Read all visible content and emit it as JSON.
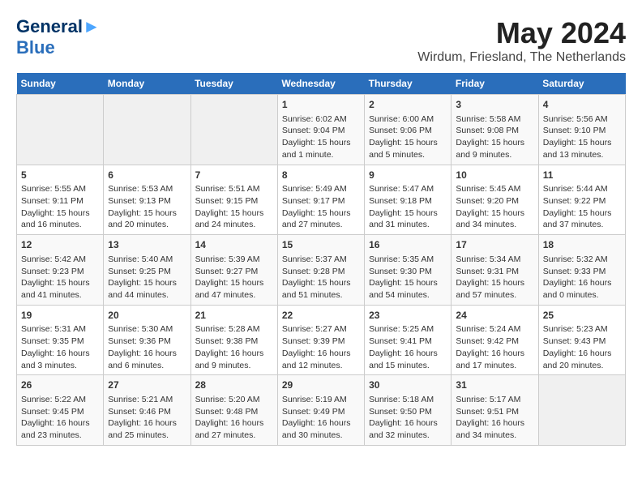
{
  "header": {
    "logo_line1": "General",
    "logo_line2": "Blue",
    "month": "May 2024",
    "location": "Wirdum, Friesland, The Netherlands"
  },
  "weekdays": [
    "Sunday",
    "Monday",
    "Tuesday",
    "Wednesday",
    "Thursday",
    "Friday",
    "Saturday"
  ],
  "weeks": [
    [
      {
        "day": "",
        "sunrise": "",
        "sunset": "",
        "daylight": ""
      },
      {
        "day": "",
        "sunrise": "",
        "sunset": "",
        "daylight": ""
      },
      {
        "day": "",
        "sunrise": "",
        "sunset": "",
        "daylight": ""
      },
      {
        "day": "1",
        "sunrise": "Sunrise: 6:02 AM",
        "sunset": "Sunset: 9:04 PM",
        "daylight": "Daylight: 15 hours and 1 minute."
      },
      {
        "day": "2",
        "sunrise": "Sunrise: 6:00 AM",
        "sunset": "Sunset: 9:06 PM",
        "daylight": "Daylight: 15 hours and 5 minutes."
      },
      {
        "day": "3",
        "sunrise": "Sunrise: 5:58 AM",
        "sunset": "Sunset: 9:08 PM",
        "daylight": "Daylight: 15 hours and 9 minutes."
      },
      {
        "day": "4",
        "sunrise": "Sunrise: 5:56 AM",
        "sunset": "Sunset: 9:10 PM",
        "daylight": "Daylight: 15 hours and 13 minutes."
      }
    ],
    [
      {
        "day": "5",
        "sunrise": "Sunrise: 5:55 AM",
        "sunset": "Sunset: 9:11 PM",
        "daylight": "Daylight: 15 hours and 16 minutes."
      },
      {
        "day": "6",
        "sunrise": "Sunrise: 5:53 AM",
        "sunset": "Sunset: 9:13 PM",
        "daylight": "Daylight: 15 hours and 20 minutes."
      },
      {
        "day": "7",
        "sunrise": "Sunrise: 5:51 AM",
        "sunset": "Sunset: 9:15 PM",
        "daylight": "Daylight: 15 hours and 24 minutes."
      },
      {
        "day": "8",
        "sunrise": "Sunrise: 5:49 AM",
        "sunset": "Sunset: 9:17 PM",
        "daylight": "Daylight: 15 hours and 27 minutes."
      },
      {
        "day": "9",
        "sunrise": "Sunrise: 5:47 AM",
        "sunset": "Sunset: 9:18 PM",
        "daylight": "Daylight: 15 hours and 31 minutes."
      },
      {
        "day": "10",
        "sunrise": "Sunrise: 5:45 AM",
        "sunset": "Sunset: 9:20 PM",
        "daylight": "Daylight: 15 hours and 34 minutes."
      },
      {
        "day": "11",
        "sunrise": "Sunrise: 5:44 AM",
        "sunset": "Sunset: 9:22 PM",
        "daylight": "Daylight: 15 hours and 37 minutes."
      }
    ],
    [
      {
        "day": "12",
        "sunrise": "Sunrise: 5:42 AM",
        "sunset": "Sunset: 9:23 PM",
        "daylight": "Daylight: 15 hours and 41 minutes."
      },
      {
        "day": "13",
        "sunrise": "Sunrise: 5:40 AM",
        "sunset": "Sunset: 9:25 PM",
        "daylight": "Daylight: 15 hours and 44 minutes."
      },
      {
        "day": "14",
        "sunrise": "Sunrise: 5:39 AM",
        "sunset": "Sunset: 9:27 PM",
        "daylight": "Daylight: 15 hours and 47 minutes."
      },
      {
        "day": "15",
        "sunrise": "Sunrise: 5:37 AM",
        "sunset": "Sunset: 9:28 PM",
        "daylight": "Daylight: 15 hours and 51 minutes."
      },
      {
        "day": "16",
        "sunrise": "Sunrise: 5:35 AM",
        "sunset": "Sunset: 9:30 PM",
        "daylight": "Daylight: 15 hours and 54 minutes."
      },
      {
        "day": "17",
        "sunrise": "Sunrise: 5:34 AM",
        "sunset": "Sunset: 9:31 PM",
        "daylight": "Daylight: 15 hours and 57 minutes."
      },
      {
        "day": "18",
        "sunrise": "Sunrise: 5:32 AM",
        "sunset": "Sunset: 9:33 PM",
        "daylight": "Daylight: 16 hours and 0 minutes."
      }
    ],
    [
      {
        "day": "19",
        "sunrise": "Sunrise: 5:31 AM",
        "sunset": "Sunset: 9:35 PM",
        "daylight": "Daylight: 16 hours and 3 minutes."
      },
      {
        "day": "20",
        "sunrise": "Sunrise: 5:30 AM",
        "sunset": "Sunset: 9:36 PM",
        "daylight": "Daylight: 16 hours and 6 minutes."
      },
      {
        "day": "21",
        "sunrise": "Sunrise: 5:28 AM",
        "sunset": "Sunset: 9:38 PM",
        "daylight": "Daylight: 16 hours and 9 minutes."
      },
      {
        "day": "22",
        "sunrise": "Sunrise: 5:27 AM",
        "sunset": "Sunset: 9:39 PM",
        "daylight": "Daylight: 16 hours and 12 minutes."
      },
      {
        "day": "23",
        "sunrise": "Sunrise: 5:25 AM",
        "sunset": "Sunset: 9:41 PM",
        "daylight": "Daylight: 16 hours and 15 minutes."
      },
      {
        "day": "24",
        "sunrise": "Sunrise: 5:24 AM",
        "sunset": "Sunset: 9:42 PM",
        "daylight": "Daylight: 16 hours and 17 minutes."
      },
      {
        "day": "25",
        "sunrise": "Sunrise: 5:23 AM",
        "sunset": "Sunset: 9:43 PM",
        "daylight": "Daylight: 16 hours and 20 minutes."
      }
    ],
    [
      {
        "day": "26",
        "sunrise": "Sunrise: 5:22 AM",
        "sunset": "Sunset: 9:45 PM",
        "daylight": "Daylight: 16 hours and 23 minutes."
      },
      {
        "day": "27",
        "sunrise": "Sunrise: 5:21 AM",
        "sunset": "Sunset: 9:46 PM",
        "daylight": "Daylight: 16 hours and 25 minutes."
      },
      {
        "day": "28",
        "sunrise": "Sunrise: 5:20 AM",
        "sunset": "Sunset: 9:48 PM",
        "daylight": "Daylight: 16 hours and 27 minutes."
      },
      {
        "day": "29",
        "sunrise": "Sunrise: 5:19 AM",
        "sunset": "Sunset: 9:49 PM",
        "daylight": "Daylight: 16 hours and 30 minutes."
      },
      {
        "day": "30",
        "sunrise": "Sunrise: 5:18 AM",
        "sunset": "Sunset: 9:50 PM",
        "daylight": "Daylight: 16 hours and 32 minutes."
      },
      {
        "day": "31",
        "sunrise": "Sunrise: 5:17 AM",
        "sunset": "Sunset: 9:51 PM",
        "daylight": "Daylight: 16 hours and 34 minutes."
      },
      {
        "day": "",
        "sunrise": "",
        "sunset": "",
        "daylight": ""
      }
    ]
  ]
}
